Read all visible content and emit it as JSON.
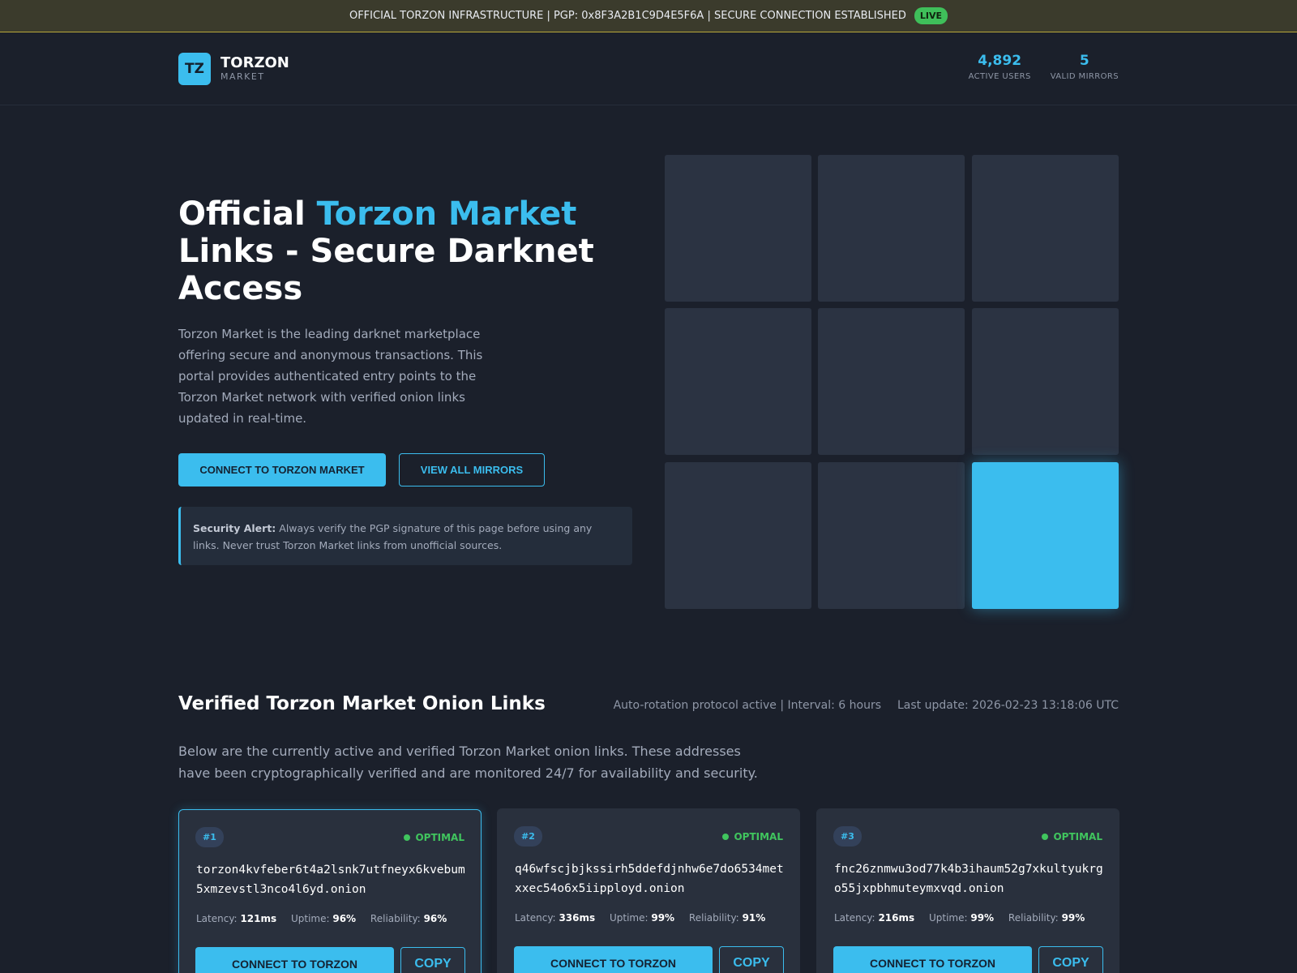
{
  "banner": {
    "text": "OFFICIAL TORZON INFRASTRUCTURE | PGP: 0x8F3A2B1C9D4E5F6A | SECURE CONNECTION ESTABLISHED",
    "badge": "LIVE"
  },
  "header": {
    "logo_mark": "TZ",
    "logo_name": "TORZON",
    "logo_sub": "MARKET",
    "stats": [
      {
        "value": "4,892",
        "label": "ACTIVE USERS"
      },
      {
        "value": "5",
        "label": "VALID MIRRORS"
      }
    ]
  },
  "hero": {
    "title_start": "Official ",
    "title_accent": "Torzon Market",
    "title_end": " Links - Secure Darknet Access",
    "description": "Torzon Market is the leading darknet marketplace offering secure and anonymous transactions. This portal provides authenticated entry points to the Torzon Market network with verified onion links updated in real-time.",
    "primary_button": "CONNECT TO TORZON MARKET",
    "secondary_button": "VIEW ALL MIRRORS",
    "alert_label": "Security Alert:",
    "alert_text": " Always verify the PGP signature of this page before using any links. Never trust Torzon Market links from unofficial sources.",
    "grid_active_tile": 9
  },
  "links_section": {
    "title": "Verified Torzon Market Onion Links",
    "rotation": "Auto-rotation protocol active | Interval: 6 hours",
    "last_update": "Last update: 2026-02-23 13:18:06 UTC",
    "description": "Below are the currently active and verified Torzon Market onion links. These addresses have been cryptographically verified and are monitored 24/7 for availability and security.",
    "latency_label": "Latency:",
    "uptime_label": "Uptime:",
    "reliability_label": "Reliability:",
    "connect_label": "CONNECT TO TORZON",
    "copy_label": "COPY",
    "cards": [
      {
        "number": "#1",
        "status": "OPTIMAL",
        "address": "torzon4kvfeber6t4a2lsnk7utfneyx6kvebum5xmzevstl3nco4l6yd.onion",
        "latency": "121ms",
        "uptime": "96%",
        "reliability": "96%"
      },
      {
        "number": "#2",
        "status": "OPTIMAL",
        "address": "q46wfscjbjkssirh5ddefdjnhw6e7do6534metxxec54o6x5iipployd.onion",
        "latency": "336ms",
        "uptime": "99%",
        "reliability": "91%"
      },
      {
        "number": "#3",
        "status": "OPTIMAL",
        "address": "fnc26znmwu3od77k4b3ihaum52g7xkultyukrgo55jxpbhmuteymxvqd.onion",
        "latency": "216ms",
        "uptime": "99%",
        "reliability": "99%"
      }
    ]
  },
  "colors": {
    "accent": "#3bbdee",
    "status_ok": "#40c55e",
    "background": "#1b202b"
  }
}
